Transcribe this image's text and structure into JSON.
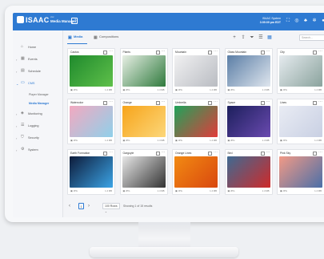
{
  "header": {
    "brand": "ISAAC",
    "app_sub": "xxx",
    "app_name": "Media Manager",
    "system_title": "ISAAC System",
    "system_time": "3:09:09 pm EDT"
  },
  "sidebar": {
    "items": [
      {
        "label": "Home",
        "icon": "home-icon"
      },
      {
        "label": "Events",
        "icon": "calendar-icon"
      },
      {
        "label": "Schedule",
        "icon": "schedule-icon"
      },
      {
        "label": "CMS",
        "icon": "monitor-icon"
      },
      {
        "label": "Monitoring",
        "icon": "monitoring-icon"
      },
      {
        "label": "Logging",
        "icon": "logging-icon"
      },
      {
        "label": "Security",
        "icon": "shield-icon"
      },
      {
        "label": "System",
        "icon": "gear-icon"
      }
    ],
    "cms_children": [
      "Player Manager",
      "Media Manager"
    ]
  },
  "main": {
    "tabs": [
      "Media",
      "Compositions"
    ],
    "search_placeholder": "Search...",
    "cards": [
      {
        "title": "Cactus",
        "type": "JPG",
        "size": "1.4 MB",
        "colors": [
          "#1f8a2d",
          "#5fc04a"
        ]
      },
      {
        "title": "Plants",
        "type": "JPG",
        "size": "1.4 MB",
        "colors": [
          "#e8efe5",
          "#2f7a3d"
        ]
      },
      {
        "title": "Mountain",
        "type": "JPG",
        "size": "1.4 MB",
        "colors": [
          "#f1f1f2",
          "#b9bcc2"
        ]
      },
      {
        "title": "Glass Mountain",
        "type": "JPG",
        "size": "1.4 MB",
        "colors": [
          "#5b7ea6",
          "#dfe6ee"
        ]
      },
      {
        "title": "City",
        "type": "JPG",
        "size": "1.4 MB",
        "colors": [
          "#e6ebef",
          "#8aa39d"
        ]
      },
      {
        "title": "Watercolor",
        "type": "JPG",
        "size": "1.4 MB",
        "colors": [
          "#f3a9c0",
          "#8fd0ea"
        ]
      },
      {
        "title": "Orange",
        "type": "JPG",
        "size": "1.4 MB",
        "colors": [
          "#f7a41a",
          "#fcd77a"
        ]
      },
      {
        "title": "Umbrella",
        "type": "JPG",
        "size": "1.4 MB",
        "colors": [
          "#1fa35a",
          "#e23b3b"
        ]
      },
      {
        "title": "Space",
        "type": "JPG",
        "size": "1.4 MB",
        "colors": [
          "#1c1f5c",
          "#6a4ab0"
        ]
      },
      {
        "title": "Lines",
        "type": "JPG",
        "size": "1.4 MB",
        "colors": [
          "#e9ecf4",
          "#c9d0e3"
        ]
      },
      {
        "title": "Earth Formation",
        "type": "JPG",
        "size": "1.4 MB",
        "colors": [
          "#0d1b3a",
          "#3ba4e6"
        ]
      },
      {
        "title": "Gargoyle",
        "type": "JPG",
        "size": "1.4 MB",
        "colors": [
          "#e7e7e7",
          "#333333"
        ]
      },
      {
        "title": "Orange Lines",
        "type": "JPG",
        "size": "1.4 MB",
        "colors": [
          "#f28a12",
          "#d9480f"
        ]
      },
      {
        "title": "Bird",
        "type": "JPG",
        "size": "1.4 MB",
        "colors": [
          "#3e6a92",
          "#cf2a2a"
        ]
      },
      {
        "title": "Pink Sky",
        "type": "JPG",
        "size": "1.4 MB",
        "colors": [
          "#f29a86",
          "#4b6fa8"
        ]
      }
    ]
  },
  "footer": {
    "page": "1",
    "per_page": "100 Rows",
    "showing": "Showing 1 of 15 results"
  },
  "colors": {
    "accent": "#2e7ad2"
  }
}
